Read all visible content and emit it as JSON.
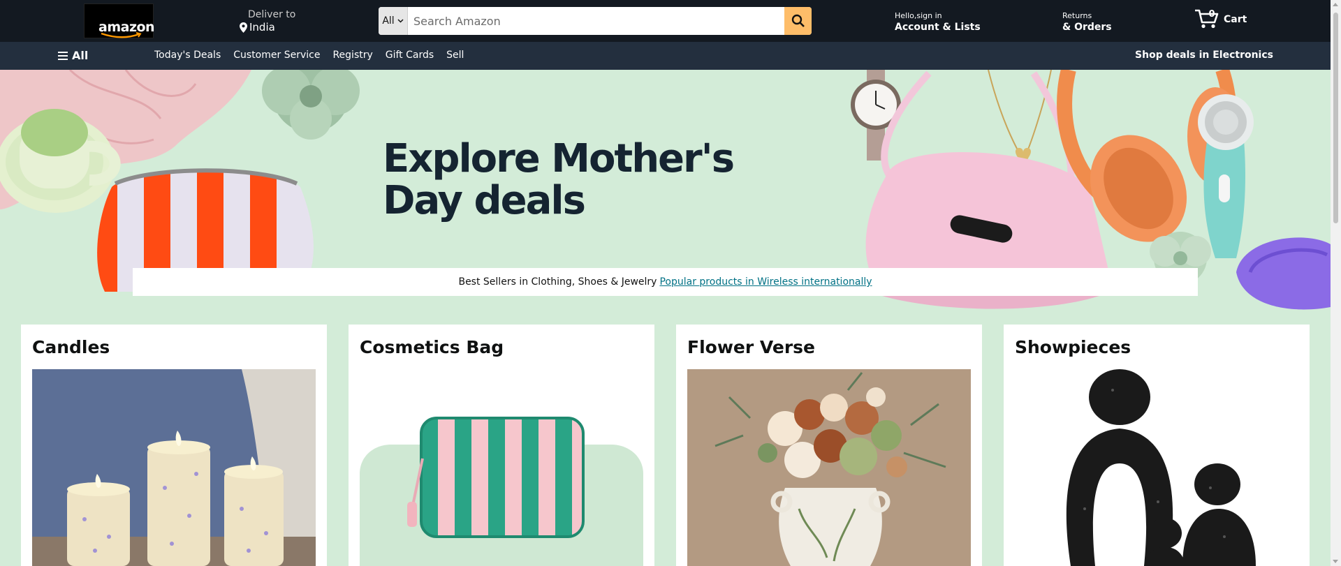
{
  "header": {
    "logo_text": "amazon",
    "deliver_label": "Deliver to",
    "deliver_location": "India",
    "search_category": "All",
    "search_placeholder": "Search Amazon",
    "account_line1": "Hello,sign in",
    "account_line2": "Account & Lists",
    "returns_line1": "Returns",
    "returns_line2": "& Orders",
    "cart_count": "0",
    "cart_label": "Cart"
  },
  "subnav": {
    "all_label": "All",
    "links": [
      "Today's Deals",
      "Customer Service",
      "Registry",
      "Gift Cards",
      "Sell"
    ],
    "promo": "Shop deals in Electronics"
  },
  "hero": {
    "title": "Explore Mother's Day deals",
    "bestsellers_text": "Best Sellers in Clothing, Shoes & Jewelry",
    "bestsellers_link": "Popular products in Wireless internationally"
  },
  "cards": [
    {
      "title": "Candles"
    },
    {
      "title": "Cosmetics Bag"
    },
    {
      "title": "Flower Verse"
    },
    {
      "title": "Showpieces"
    }
  ],
  "colors": {
    "nav_bg": "#131921",
    "subnav_bg": "#232f3e",
    "search_button": "#febd69",
    "hero_bg": "#d3ecd8",
    "link": "#007185"
  }
}
